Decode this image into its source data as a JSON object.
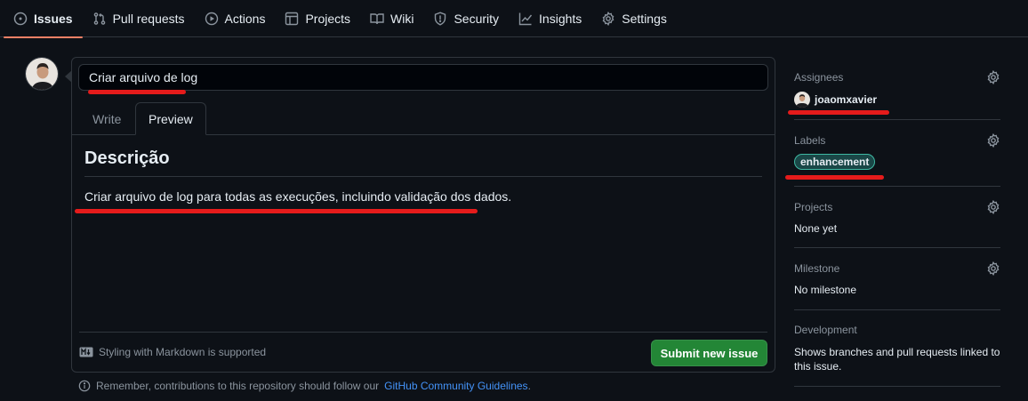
{
  "nav": {
    "tabs": [
      {
        "label": "Issues",
        "icon": "issue-opened-icon",
        "active": true
      },
      {
        "label": "Pull requests",
        "icon": "git-pull-request-icon"
      },
      {
        "label": "Actions",
        "icon": "play-icon"
      },
      {
        "label": "Projects",
        "icon": "table-icon"
      },
      {
        "label": "Wiki",
        "icon": "book-icon"
      },
      {
        "label": "Security",
        "icon": "shield-icon"
      },
      {
        "label": "Insights",
        "icon": "graph-icon"
      },
      {
        "label": "Settings",
        "icon": "gear-icon"
      }
    ]
  },
  "issue": {
    "title_value": "Criar arquivo de log",
    "tabs": {
      "write": "Write",
      "preview": "Preview"
    },
    "preview": {
      "heading": "Descrição",
      "body": "Criar arquivo de log para todas as execuções, incluindo validação dos dados."
    },
    "markdown_hint": "Styling with Markdown is supported",
    "submit_label": "Submit new issue"
  },
  "guidelines": {
    "prefix": "Remember, contributions to this repository should follow our",
    "link": "GitHub Community Guidelines",
    "suffix": "."
  },
  "sidebar": {
    "assignees": {
      "heading": "Assignees",
      "user": "joaomxavier"
    },
    "labels": {
      "heading": "Labels",
      "label": "enhancement"
    },
    "projects": {
      "heading": "Projects",
      "value": "None yet"
    },
    "milestone": {
      "heading": "Milestone",
      "value": "No milestone"
    },
    "development": {
      "heading": "Development",
      "value": "Shows branches and pull requests linked to this issue."
    }
  },
  "colors": {
    "accent_tab": "#f78166",
    "submit": "#238636",
    "link": "#4493f8",
    "annotation": "#e51b1b"
  }
}
